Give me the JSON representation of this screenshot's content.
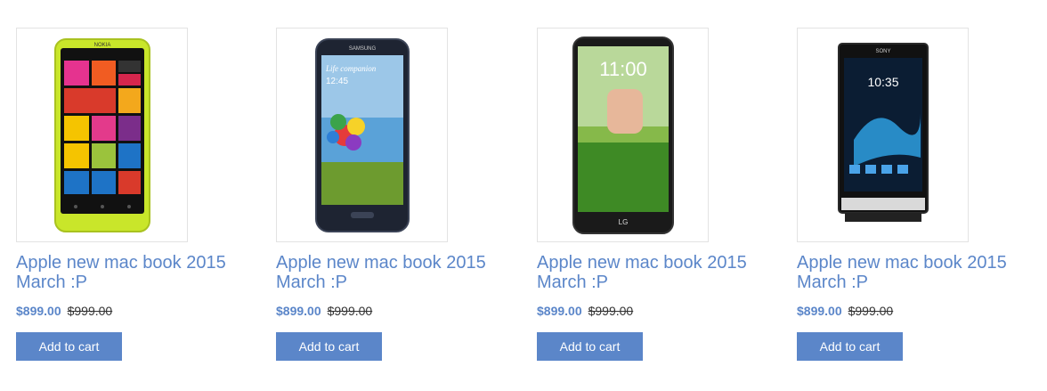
{
  "products": [
    {
      "image_icon": "yellow-nokia-lumia-phone",
      "title": "Apple new mac book 2015 March :P",
      "price": "$899.00",
      "old_price": "$999.00",
      "button_label": "Add to cart",
      "phone_brand": "NOKIA"
    },
    {
      "image_icon": "samsung-galaxy-s4-phone",
      "title": "Apple new mac book 2015 March :P",
      "price": "$899.00",
      "old_price": "$999.00",
      "button_label": "Add to cart",
      "phone_brand": "SAMSUNG",
      "screen_text": "Life companion",
      "screen_time": "12:45"
    },
    {
      "image_icon": "lg-g2-phone",
      "title": "Apple new mac book 2015 March :P",
      "price": "$899.00",
      "old_price": "$999.00",
      "button_label": "Add to cart",
      "phone_brand": "LG",
      "screen_time": "11:00"
    },
    {
      "image_icon": "sony-xperia-phone",
      "title": "Apple new mac book 2015 March :P",
      "price": "$899.00",
      "old_price": "$999.00",
      "button_label": "Add to cart",
      "phone_brand": "SONY",
      "screen_time": "10:35"
    }
  ],
  "colors": {
    "accent": "#5b86c9",
    "border": "#e3e3e3"
  }
}
